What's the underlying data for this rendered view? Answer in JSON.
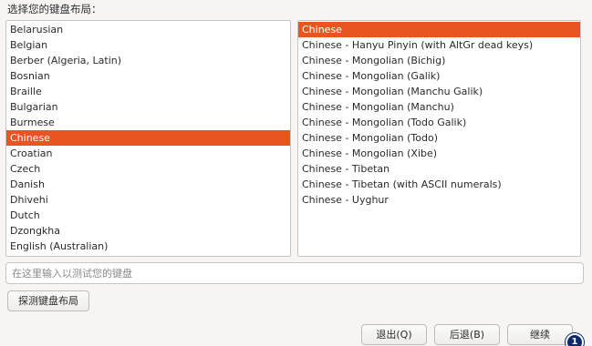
{
  "heading": "选择您的键盘布局：",
  "layouts": {
    "items": [
      {
        "label": "Belarusian"
      },
      {
        "label": "Belgian"
      },
      {
        "label": "Berber (Algeria, Latin)"
      },
      {
        "label": "Bosnian"
      },
      {
        "label": "Braille"
      },
      {
        "label": "Bulgarian"
      },
      {
        "label": "Burmese"
      },
      {
        "label": "Chinese",
        "selected": true
      },
      {
        "label": "Croatian"
      },
      {
        "label": "Czech"
      },
      {
        "label": "Danish"
      },
      {
        "label": "Dhivehi"
      },
      {
        "label": "Dutch"
      },
      {
        "label": "Dzongkha"
      },
      {
        "label": "English (Australian)"
      }
    ]
  },
  "variants": {
    "items": [
      {
        "label": "Chinese",
        "selected": true
      },
      {
        "label": "Chinese - Hanyu Pinyin (with AltGr dead keys)"
      },
      {
        "label": "Chinese - Mongolian (Bichig)"
      },
      {
        "label": "Chinese - Mongolian (Galik)"
      },
      {
        "label": "Chinese - Mongolian (Manchu Galik)"
      },
      {
        "label": "Chinese - Mongolian (Manchu)"
      },
      {
        "label": "Chinese - Mongolian (Todo Galik)"
      },
      {
        "label": "Chinese - Mongolian (Todo)"
      },
      {
        "label": "Chinese - Mongolian (Xibe)"
      },
      {
        "label": "Chinese - Tibetan"
      },
      {
        "label": "Chinese - Tibetan (with ASCII numerals)"
      },
      {
        "label": "Chinese - Uyghur"
      }
    ]
  },
  "test_input": {
    "placeholder": "在这里输入以测试您的键盘",
    "value": ""
  },
  "buttons": {
    "detect": "探测键盘布局",
    "quit": "退出(Q)",
    "back": "后退(B)",
    "continue": "继续"
  },
  "badge": {
    "text": "1"
  },
  "colors": {
    "selection": "#e95420",
    "badge": "#0a2a6b"
  }
}
